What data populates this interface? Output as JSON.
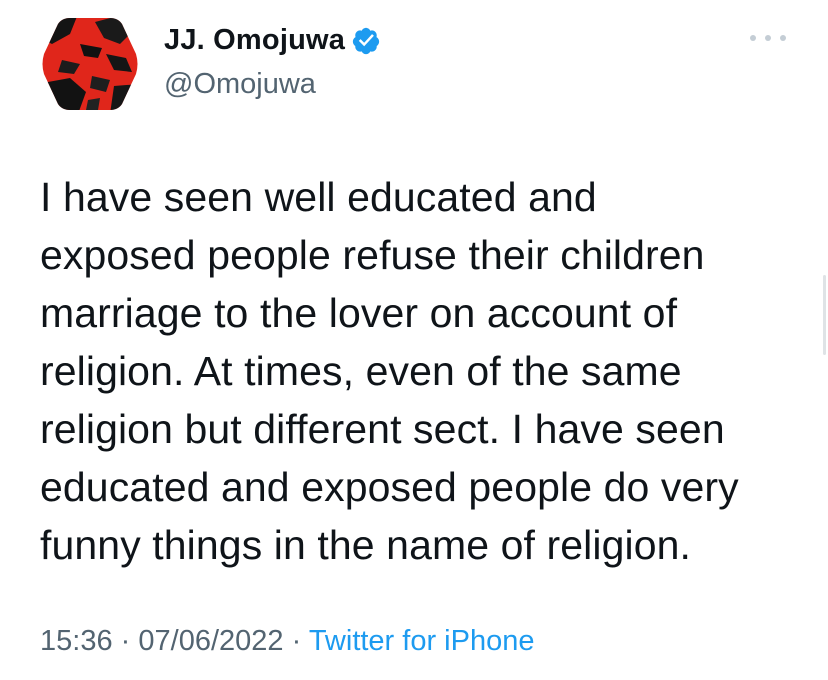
{
  "tweet": {
    "display_name": "JJ. Omojuwa",
    "handle": "@Omojuwa",
    "verified_icon": "verified-badge-icon",
    "more_icon": "more-dots-icon",
    "text_lines": [
      "I have seen well educated and",
      "exposed people refuse their children",
      "marriage to the lover on account of",
      "religion. At times, even of the same",
      "religion but different sect. I have seen",
      "educated and exposed people do very",
      "funny things in the name of religion."
    ],
    "time": "15:36",
    "separator": "·",
    "date": "07/06/2022",
    "source": "Twitter for iPhone"
  },
  "colors": {
    "text": "#0f1419",
    "secondary": "#536471",
    "accent": "#1d9bf0",
    "avatar_red": "#e0261b"
  }
}
